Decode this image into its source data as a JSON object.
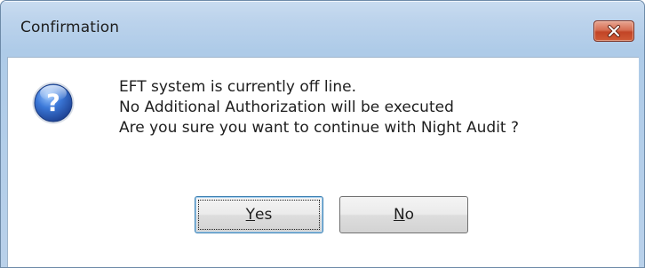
{
  "window": {
    "title": "Confirmation",
    "close_icon": "close-icon"
  },
  "dialog": {
    "icon": "question-icon",
    "message_lines": [
      "EFT system is currently off line.",
      "No Additional Authorization will be executed",
      "Are you sure you want to continue with Night Audit ?"
    ]
  },
  "buttons": {
    "yes": {
      "accel": "Y",
      "rest": "es"
    },
    "no": {
      "accel": "N",
      "rest": "o"
    }
  },
  "colors": {
    "close_button": "#c24426",
    "question_icon": "#2f5fb8",
    "frame": "#b9d1ea",
    "default_focus": "#3c7fb1"
  }
}
